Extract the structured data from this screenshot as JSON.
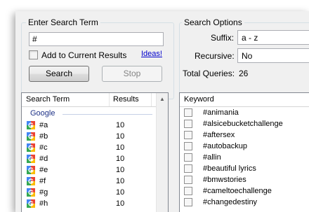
{
  "search": {
    "group_title": "Enter Search Term",
    "term_value": "#",
    "add_current_label": "Add to Current Results",
    "ideas_link": "Ideas!",
    "search_button": "Search",
    "stop_button": "Stop"
  },
  "options": {
    "group_title": "Search Options",
    "suffix_label": "Suffix:",
    "suffix_value": "a - z",
    "recursive_label": "Recursive:",
    "recursive_value": "No",
    "total_queries_label": "Total Queries:",
    "total_queries_value": "26"
  },
  "results": {
    "col_term": "Search Term",
    "col_results": "Results",
    "group_name": "Google",
    "rows": [
      {
        "term": "#a",
        "results": "10"
      },
      {
        "term": "#b",
        "results": "10"
      },
      {
        "term": "#c",
        "results": "10"
      },
      {
        "term": "#d",
        "results": "10"
      },
      {
        "term": "#e",
        "results": "10"
      },
      {
        "term": "#f",
        "results": "10"
      },
      {
        "term": "#g",
        "results": "10"
      },
      {
        "term": "#h",
        "results": "10"
      }
    ]
  },
  "keywords": {
    "col_keyword": "Keyword",
    "items": [
      "#animania",
      "#alsicebucketchallenge",
      "#aftersex",
      "#autobackup",
      "#allin",
      "#beautiful lyrics",
      "#bmwstories",
      "#cameltoechallenge",
      "#changedestiny"
    ]
  },
  "colors": {
    "group_header": "#1e3287",
    "link": "#0000cc"
  }
}
